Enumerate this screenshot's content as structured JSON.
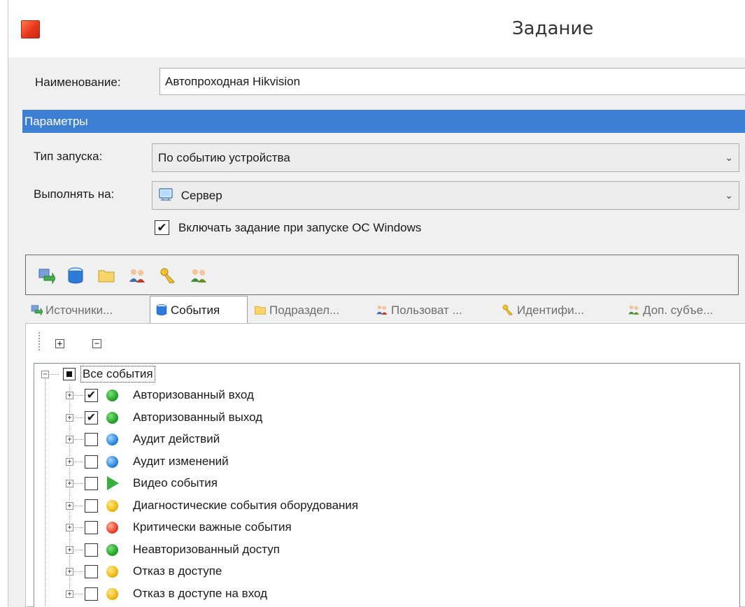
{
  "window": {
    "title": "Задание"
  },
  "form": {
    "name_label": "Наименование:",
    "name_value": "Автопроходная Hikvision"
  },
  "parameters": {
    "header": "Параметры",
    "launch_type_label": "Тип запуска:",
    "launch_type_value": "По событию устройства",
    "run_on_label": "Выполнять на:",
    "run_on_value": "Сервер",
    "enable_on_start_label": "Включать задание при запуске ОС Windows",
    "enable_on_start_checked": true
  },
  "toolbar": {
    "icons": [
      "sources-icon",
      "events-icon",
      "folder-icon",
      "users-icon",
      "keys-icon",
      "extra-subjects-icon"
    ]
  },
  "tabs": [
    {
      "label": "Источники...",
      "icon": "sources-icon",
      "active": false
    },
    {
      "label": "События",
      "icon": "events-icon",
      "active": true
    },
    {
      "label": "Подраздел...",
      "icon": "folder-icon",
      "active": false
    },
    {
      "label": "Пользоват ...",
      "icon": "users-icon",
      "active": false
    },
    {
      "label": "Идентифи...",
      "icon": "keys-icon",
      "active": false
    },
    {
      "label": "Доп. субъе...",
      "icon": "extra-subjects-icon",
      "active": false
    }
  ],
  "tree": {
    "root": {
      "label": "Все события",
      "state": "indeterminate"
    },
    "items": [
      {
        "label": "Авторизованный вход",
        "checked": true,
        "status": "green"
      },
      {
        "label": "Авторизованный выход",
        "checked": true,
        "status": "green"
      },
      {
        "label": "Аудит действий",
        "checked": false,
        "status": "blue"
      },
      {
        "label": "Аудит изменений",
        "checked": false,
        "status": "blue"
      },
      {
        "label": "Видео события",
        "checked": false,
        "status": "video"
      },
      {
        "label": "Диагностические события оборудования",
        "checked": false,
        "status": "yellow"
      },
      {
        "label": "Критически важные события",
        "checked": false,
        "status": "red"
      },
      {
        "label": "Неавторизованный доступ",
        "checked": false,
        "status": "green"
      },
      {
        "label": "Отказ в доступе",
        "checked": false,
        "status": "yellow"
      },
      {
        "label": "Отказ в доступе на вход",
        "checked": false,
        "status": "yellow"
      }
    ]
  },
  "colors": {
    "section_header": "#3c7fd3",
    "green": "#22a52b",
    "blue": "#2a86e0",
    "yellow": "#f0b812",
    "red": "#e8452a"
  }
}
